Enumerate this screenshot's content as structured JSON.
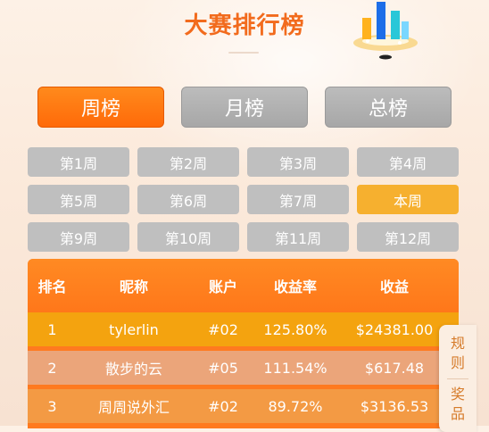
{
  "header": {
    "title": "大赛排行榜"
  },
  "main_tabs": [
    {
      "label": "周榜"
    },
    {
      "label": "月榜"
    },
    {
      "label": "总榜"
    }
  ],
  "weeks": [
    "第1周",
    "第2周",
    "第3周",
    "第4周",
    "第5周",
    "第6周",
    "第7周",
    "本周",
    "第9周",
    "第10周",
    "第11周",
    "第12周"
  ],
  "table": {
    "headers": [
      "排名",
      "昵称",
      "账户",
      "收益率",
      "收益"
    ],
    "rows": [
      [
        "1",
        "tylerlin",
        "#02",
        "125.80%",
        "$24381.00"
      ],
      [
        "2",
        "散步的云",
        "#05",
        "111.54%",
        "$617.48"
      ],
      [
        "3",
        "周周说外汇",
        "#02",
        "89.72%",
        "$3136.53"
      ]
    ]
  },
  "side_panel": {
    "rules_label": "规则",
    "prize_label": "奖品"
  },
  "colors": {
    "accent": "#ff7a1f",
    "active_week": "#f6b02f",
    "inactive": "#bfbfbf",
    "title": "#f26b1d"
  }
}
